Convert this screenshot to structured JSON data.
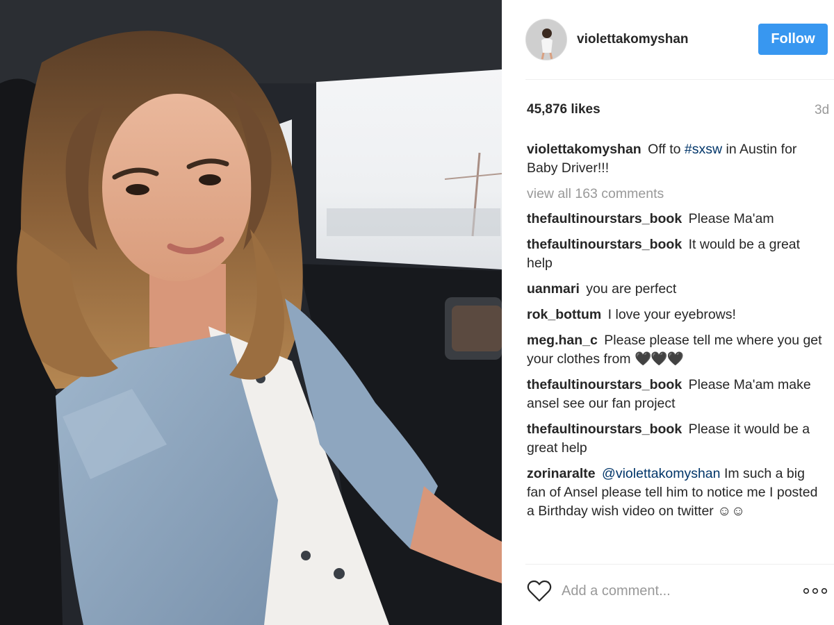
{
  "post": {
    "username": "violettakomyshan",
    "follow_label": "Follow",
    "likes": "45,876 likes",
    "age": "3d",
    "caption": {
      "user": "violettakomyshan",
      "text_before": "Off to",
      "hashtag": "#sxsw",
      "text_after": "in Austin for Baby Driver!!!"
    },
    "view_all": "view all 163 comments",
    "comments": [
      {
        "user": "thefaultinourstars_book",
        "text": "Please Ma'am"
      },
      {
        "user": "thefaultinourstars_book",
        "text": "It would be a great help"
      },
      {
        "user": "uanmari",
        "text": "you are perfect"
      },
      {
        "user": "rok_bottum",
        "text": "I love your eyebrows!"
      },
      {
        "user": "meg.han_c",
        "text": "Please please tell me where you get your clothes from",
        "emoji": "🖤🖤🖤"
      },
      {
        "user": "thefaultinourstars_book",
        "text": "Please Ma'am make ansel see our fan project"
      },
      {
        "user": "thefaultinourstars_book",
        "text": "Please it would be a great help"
      },
      {
        "user": "zorinaralte",
        "mention": "@violettakomyshan",
        "text": "Im such a big fan of Ansel please tell him to notice me I posted a Birthday wish video on twitter",
        "emoji": "☺☺"
      }
    ],
    "add_comment_placeholder": "Add a comment...",
    "icons": {
      "like": "heart-outline-icon",
      "more": "more-options-icon"
    }
  },
  "colors": {
    "follow_button": "#3897f0",
    "hashtag": "#003569",
    "muted": "#999999",
    "text": "#262626"
  }
}
